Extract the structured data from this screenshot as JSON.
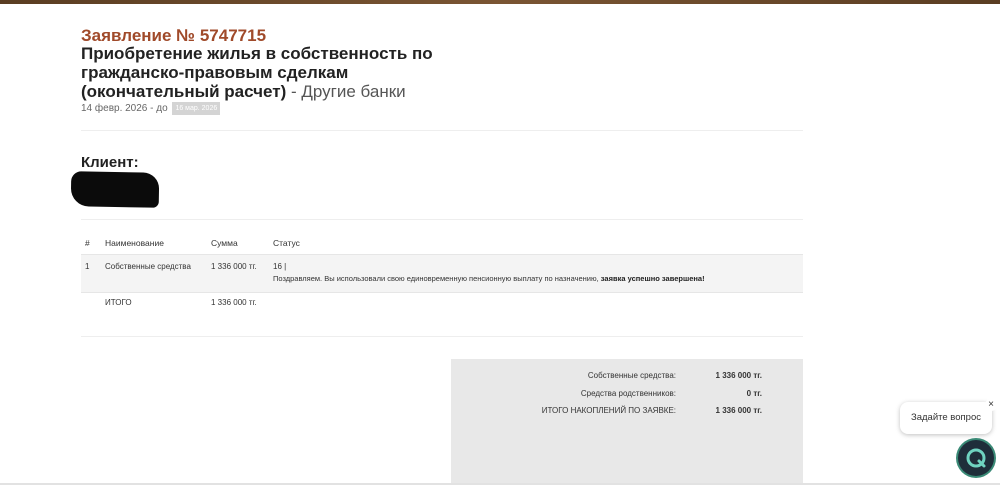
{
  "application": {
    "number_label": "Заявление № 5747715",
    "title": "Приобретение жилья в собственность по гражданско-правовым сделкам (окончательный расчет)",
    "bank_suffix": "- Другие банки",
    "date_from": "14 февр. 2026 - до",
    "date_to": "16 мар. 2026"
  },
  "client": {
    "label": "Клиент:"
  },
  "table": {
    "headers": [
      "#",
      "Наименование",
      "Сумма",
      "Статус"
    ],
    "rows": [
      {
        "num": "1",
        "name": "Собственные средства",
        "sum": "1 336 000 тг.",
        "status_code": "16 |",
        "status_text": "Поздравляем. Вы использовали свою единовременную пенсионную выплату по назначению,",
        "status_bold": "заявка успешно завершена!"
      }
    ],
    "total": {
      "label": "ИТОГО",
      "sum": "1 336 000 тг."
    }
  },
  "summary": [
    {
      "label": "Собственные средства:",
      "value": "1 336 000 тг."
    },
    {
      "label": "Средства родственников:",
      "value": "0 тг."
    },
    {
      "label": "ИТОГО НАКОПЛЕНИЙ ПО ЗАЯВКЕ:",
      "value": "1 336 000 тг."
    }
  ],
  "chat": {
    "prompt": "Задайте вопрос",
    "close_glyph": "×",
    "icon": "chat-q-icon"
  },
  "colors": {
    "accent": "#a04a2a",
    "summary_bg": "#e8e8e8"
  }
}
